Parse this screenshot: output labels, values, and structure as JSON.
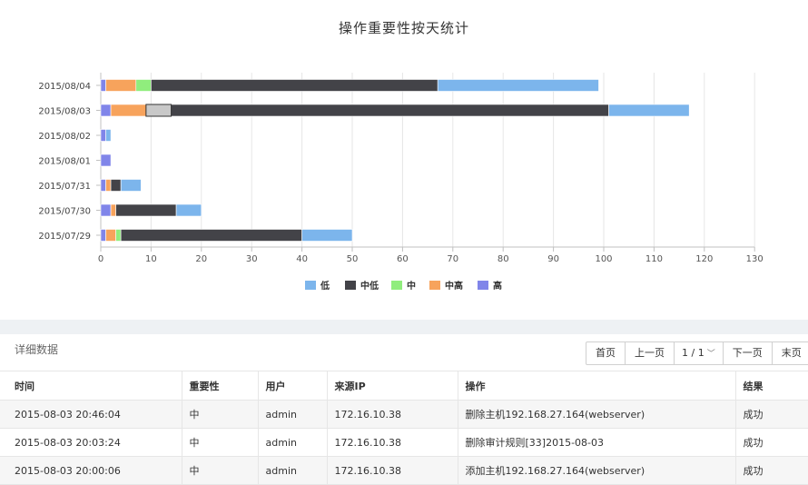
{
  "chart": {
    "title": "操作重要性按天统计"
  },
  "chart_data": {
    "type": "bar",
    "orientation": "horizontal",
    "stacked": true,
    "title": "操作重要性按天统计",
    "categories": [
      "2015/08/04",
      "2015/08/03",
      "2015/08/02",
      "2015/08/01",
      "2015/07/31",
      "2015/07/30",
      "2015/07/29"
    ],
    "xlim": [
      0,
      130
    ],
    "xticks": [
      0,
      10,
      20,
      30,
      40,
      50,
      60,
      70,
      80,
      90,
      100,
      110,
      120,
      130
    ],
    "grid": true,
    "legend_position": "bottom",
    "series_order": [
      "高",
      "中高",
      "中",
      "中低",
      "低"
    ],
    "series": [
      {
        "name": "低",
        "color": "#7cb5ec",
        "values": [
          32,
          16,
          1,
          0,
          4,
          5,
          10
        ]
      },
      {
        "name": "中低",
        "color": "#434348",
        "values": [
          57,
          92,
          0,
          0,
          2,
          12,
          36
        ]
      },
      {
        "name": "中",
        "color": "#90ed7d",
        "values": [
          3,
          0,
          0,
          0,
          0,
          0,
          1
        ]
      },
      {
        "name": "中高",
        "color": "#f7a35c",
        "values": [
          6,
          7,
          0,
          0,
          1,
          1,
          2
        ]
      },
      {
        "name": "高",
        "color": "#8085e9",
        "values": [
          1,
          2,
          1,
          2,
          1,
          2,
          1
        ]
      }
    ],
    "highlight": {
      "category": "2015/08/03",
      "series": "中低",
      "from": 9,
      "to": 14,
      "color": "#c8c8c8"
    }
  },
  "details": {
    "title": "详细数据",
    "pager": {
      "first": "首页",
      "prev": "上一页",
      "page": "1 / 1",
      "next": "下一页",
      "last": "末页"
    },
    "columns": [
      "时间",
      "重要性",
      "用户",
      "来源IP",
      "操作",
      "结果"
    ],
    "rows": [
      [
        "2015-08-03 20:46:04",
        "中",
        "admin",
        "172.16.10.38",
        "删除主机192.168.27.164(webserver)",
        "成功"
      ],
      [
        "2015-08-03 20:03:24",
        "中",
        "admin",
        "172.16.10.38",
        "删除审计规则[33]2015-08-03",
        "成功"
      ],
      [
        "2015-08-03 20:00:06",
        "中",
        "admin",
        "172.16.10.38",
        "添加主机192.168.27.164(webserver)",
        "成功"
      ]
    ]
  }
}
